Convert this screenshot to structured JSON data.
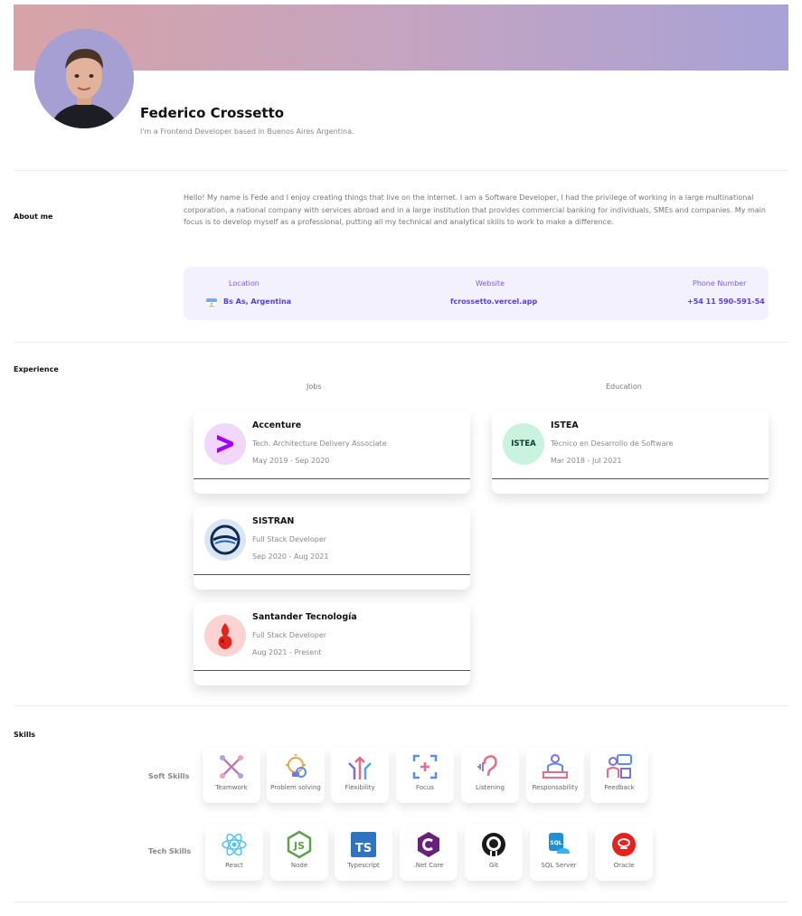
{
  "profile": {
    "name": "Federico Crossetto",
    "tagline": "I'm a Frontend Developer based in Buenos Aires Argentina."
  },
  "about": {
    "title": "About me",
    "text": "Hello! My name is Fede and I enjoy creating things that live on the internet. I am a Software Developer, I had the privilege of working in a large multinational corporation, a national company with services abroad and in a large institution that provides commercial banking for individuals, SMEs and companies. My main focus is to develop myself as a professional, putting all my technical and analytical skills to work to make a difference.",
    "location_label": "Location",
    "location_value": "Bs As, Argentina",
    "website_label": "Website",
    "website_value": "fcrossetto.vercel.app",
    "phone_label": "Phone Number",
    "phone_value": "+54 11 590-591-54"
  },
  "experience": {
    "title": "Experience",
    "jobs_label": "Jobs",
    "education_label": "Education",
    "jobs": [
      {
        "title": "Accenture",
        "role": "Tech. Architecture Delivery Associate",
        "date": "May 2019 - Sep 2020",
        "icon": "accenture-logo"
      },
      {
        "title": "SISTRAN",
        "role": "Full Stack Developer",
        "date": "Sep 2020 - Aug 2021",
        "icon": "sistran-logo"
      },
      {
        "title": "Santander Tecnología",
        "role": "Full Stack Developer",
        "date": "Aug 2021 - Present",
        "icon": "santander-logo"
      }
    ],
    "education": [
      {
        "title": "ISTEA",
        "role": "Técnico en Desarrollo de Software",
        "date": "Mar 2018 - Jul 2021",
        "logo_text": "ISTEA"
      }
    ]
  },
  "skills": {
    "title": "Skills",
    "soft_label": "Soft Skills",
    "tech_label": "Tech Skills",
    "soft": [
      "Teamwork",
      "Problem solving",
      "Flexibility",
      "Focus",
      "Listening",
      "Responsability",
      "Feedback"
    ],
    "tech": [
      "React",
      "Node",
      "Typescript",
      ".Net Core",
      "Git",
      "SQL Server",
      "Oracle"
    ]
  },
  "colors": {
    "accent": "#5a3ee0",
    "info_bg": "#f4f1ff"
  }
}
